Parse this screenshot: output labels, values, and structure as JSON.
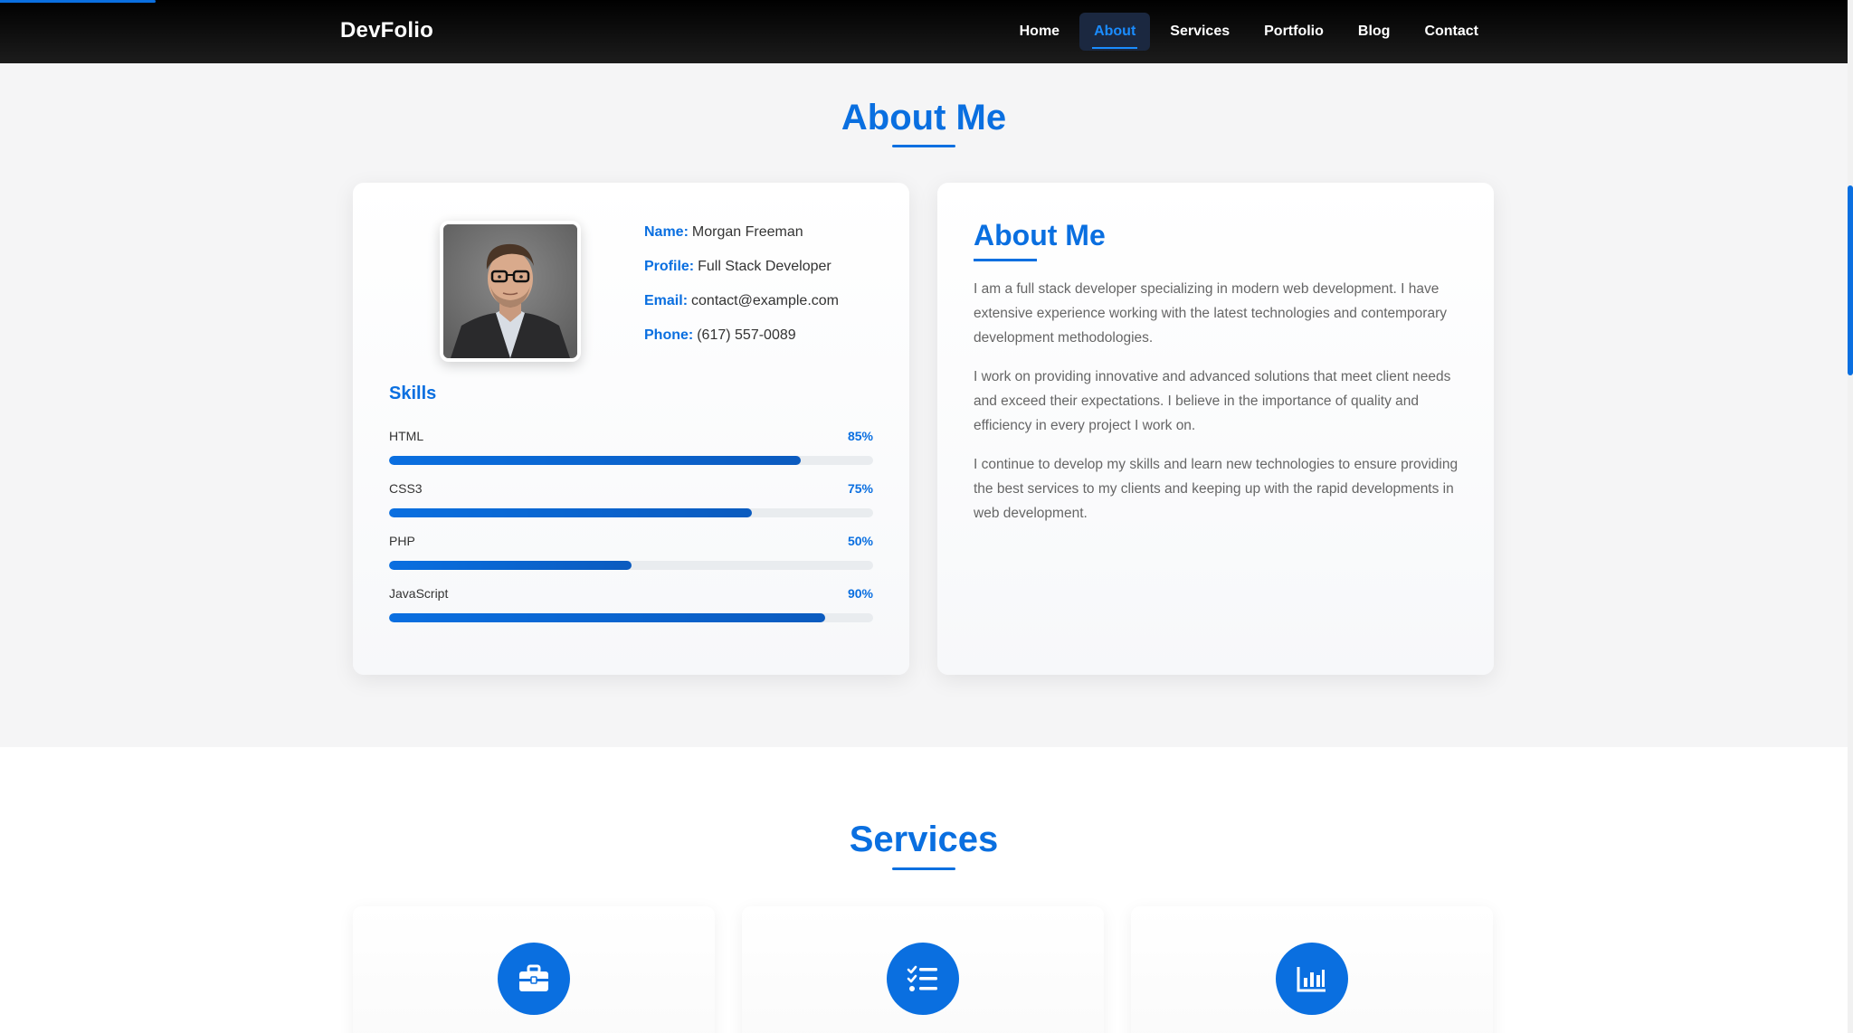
{
  "brand": "DevFolio",
  "nav": [
    {
      "label": "Home",
      "active": false
    },
    {
      "label": "About",
      "active": true
    },
    {
      "label": "Services",
      "active": false
    },
    {
      "label": "Portfolio",
      "active": false
    },
    {
      "label": "Blog",
      "active": false
    },
    {
      "label": "Contact",
      "active": false
    }
  ],
  "about": {
    "section_title": "About Me",
    "profile": {
      "name_label": "Name:",
      "name": "Morgan Freeman",
      "profile_label": "Profile:",
      "profile": "Full Stack Developer",
      "email_label": "Email:",
      "email": "contact@example.com",
      "phone_label": "Phone:",
      "phone": "(617) 557-0089"
    },
    "skills_title": "Skills",
    "skills": [
      {
        "name": "HTML",
        "percent_label": "85%",
        "value": 85
      },
      {
        "name": "CSS3",
        "percent_label": "75%",
        "value": 75
      },
      {
        "name": "PHP",
        "percent_label": "50%",
        "value": 50
      },
      {
        "name": "JavaScript",
        "percent_label": "90%",
        "value": 90
      }
    ],
    "heading": "About Me",
    "paragraphs": [
      "I am a full stack developer specializing in modern web development. I have extensive experience working with the latest technologies and contemporary development methodologies.",
      "I work on providing innovative and advanced solutions that meet client needs and exceed their expectations. I believe in the importance of quality and efficiency in every project I work on.",
      "I continue to develop my skills and learn new technologies to ensure providing the best services to my clients and keeping up with the rapid developments in web development."
    ]
  },
  "services": {
    "section_title": "Services",
    "items": [
      {
        "icon": "briefcase-icon"
      },
      {
        "icon": "checklist-icon"
      },
      {
        "icon": "bar-chart-icon"
      }
    ]
  },
  "colors": {
    "accent": "#0a6fe0",
    "navbar": "#111111",
    "background": "#f5f5f6"
  }
}
